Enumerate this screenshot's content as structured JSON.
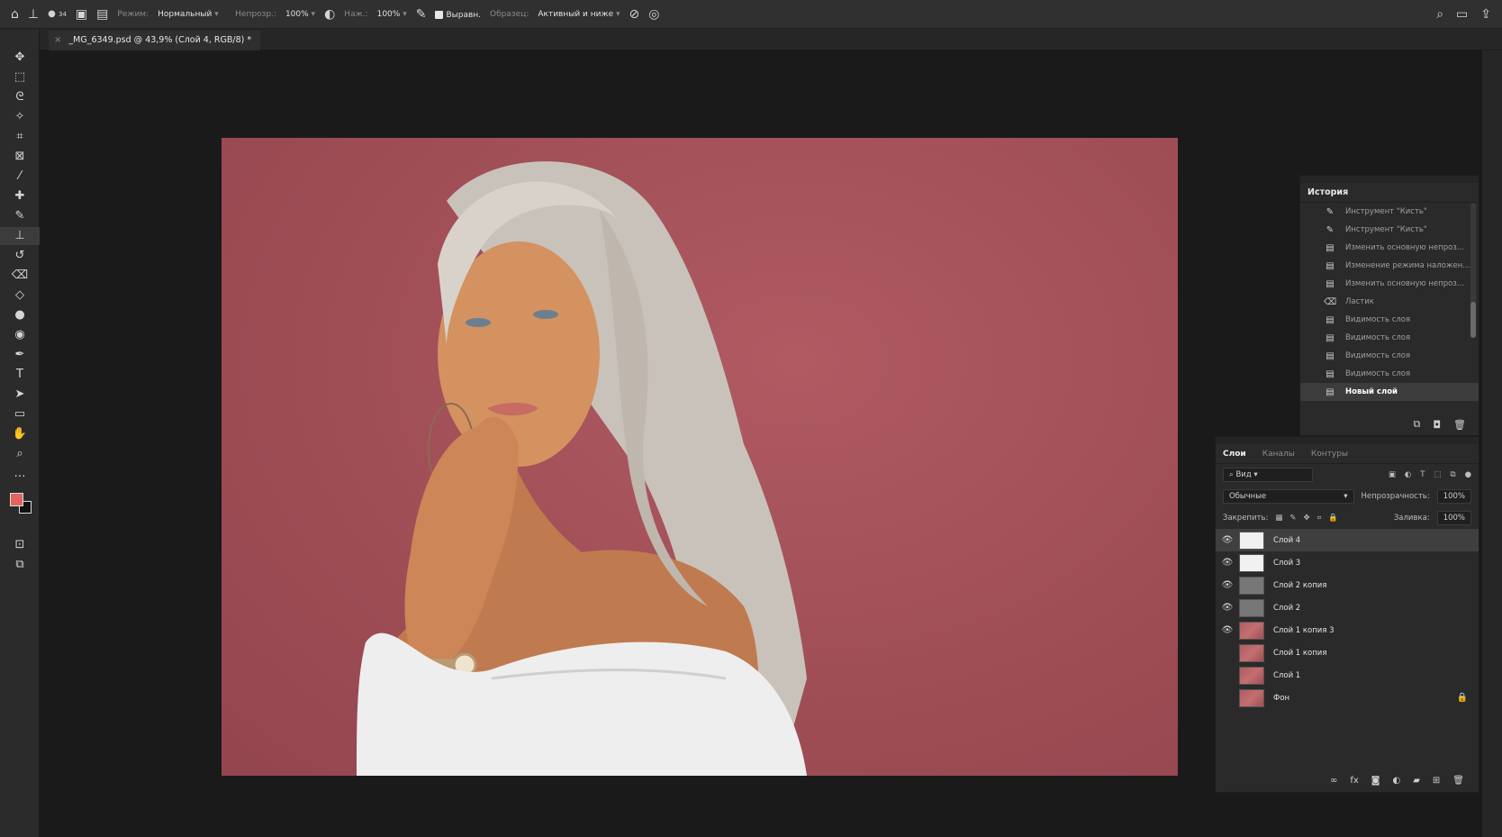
{
  "options_bar": {
    "brush_size": "34",
    "mode_label": "Режим:",
    "mode_value": "Нормальный",
    "opacity_label": "Непрозр.:",
    "opacity_value": "100%",
    "pressure_label": "Наж.:",
    "pressure_value": "100%",
    "aligned_label": "Выравн.",
    "sample_label": "Образец:",
    "sample_value": "Активный и ниже"
  },
  "document_tab": {
    "title": "_MG_6349.psd @ 43,9% (Слой 4, RGB/8) *"
  },
  "history_panel": {
    "title": "История",
    "items": [
      {
        "label": "Инструмент \"Кисть\"",
        "icon": "brush-icon"
      },
      {
        "label": "Инструмент \"Кисть\"",
        "icon": "brush-icon"
      },
      {
        "label": "Изменить основную непроз...",
        "icon": "history-doc-icon"
      },
      {
        "label": "Изменение режима наложен...",
        "icon": "history-doc-icon"
      },
      {
        "label": "Изменить основную непроз...",
        "icon": "history-doc-icon"
      },
      {
        "label": "Ластик",
        "icon": "eraser-icon"
      },
      {
        "label": "Видимость слоя",
        "icon": "history-doc-icon"
      },
      {
        "label": "Видимость слоя",
        "icon": "history-doc-icon"
      },
      {
        "label": "Видимость слоя",
        "icon": "history-doc-icon"
      },
      {
        "label": "Видимость слоя",
        "icon": "history-doc-icon"
      },
      {
        "label": "Новый слой",
        "icon": "history-doc-icon",
        "selected": true
      }
    ]
  },
  "layers_panel": {
    "tabs": [
      "Слои",
      "Каналы",
      "Контуры"
    ],
    "filter_label": "Вид",
    "blend_mode": "Обычные",
    "opacity_label": "Непрозрачность:",
    "opacity_value": "100%",
    "lock_label": "Закрепить:",
    "fill_label": "Заливка:",
    "fill_value": "100%",
    "layers": [
      {
        "name": "Слой 4",
        "thumb": "white",
        "visible": true,
        "selected": true
      },
      {
        "name": "Слой 3",
        "thumb": "white",
        "visible": true
      },
      {
        "name": "Слой 2 копия",
        "thumb": "gray",
        "visible": true
      },
      {
        "name": "Слой 2",
        "thumb": "gray",
        "visible": true
      },
      {
        "name": "Слой 1 копия 3",
        "thumb": "photo",
        "visible": true
      },
      {
        "name": "Слой 1 копия",
        "thumb": "photo",
        "visible": false
      },
      {
        "name": "Слой 1",
        "thumb": "photo",
        "visible": false
      },
      {
        "name": "Фон",
        "thumb": "photo",
        "visible": false,
        "locked": true
      }
    ]
  },
  "colors": {
    "foreground": "#e0645f",
    "background": "#111111",
    "canvas_background": "#a04e56"
  }
}
